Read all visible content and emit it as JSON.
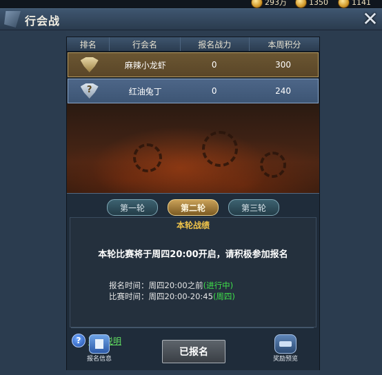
{
  "resources": [
    {
      "icon": "gold-coin-icon",
      "value": "293万"
    },
    {
      "icon": "ingot-icon",
      "value": "1350"
    },
    {
      "icon": "ingot-icon",
      "value": "1141"
    }
  ],
  "window": {
    "title": "行会战"
  },
  "table": {
    "headers": [
      "排名",
      "行会名",
      "报名战力",
      "本周积分"
    ],
    "rows": [
      {
        "rank_icon": "gold-rank-badge-icon",
        "name": "麻辣小龙虾",
        "power": "0",
        "score": "300"
      },
      {
        "rank_icon": "unknown-rank-badge-icon",
        "name": "红油兔丁",
        "power": "0",
        "score": "240"
      }
    ]
  },
  "rounds": {
    "tabs": [
      "第一轮",
      "第二轮",
      "第三轮"
    ],
    "selected": "第二轮",
    "section_title": "本轮战绩",
    "notice": "本轮比赛将于周四20:00开启，请积极参加报名",
    "signup_time_label": "报名时间：",
    "signup_time": "周四20:00之前",
    "signup_status": "(进行中)",
    "match_time_label": "比赛时间：",
    "match_time": "周四20:00-20:45",
    "match_day": "(周四)"
  },
  "help": {
    "label": "赛程说明"
  },
  "bottom": {
    "info_label": "报名信息",
    "signup_button": "已报名",
    "reward_label": "奖励预览"
  },
  "colors": {
    "accent_gold": "#f0c44a",
    "status_green": "#3fe24a"
  }
}
